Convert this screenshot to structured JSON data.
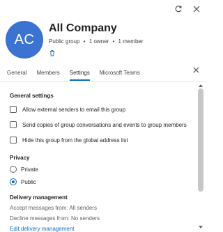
{
  "window": {
    "refresh_icon": "refresh-icon",
    "close_icon": "close-icon"
  },
  "group": {
    "initials": "AC",
    "name": "All Company",
    "type": "Public group",
    "owners": "1 owner",
    "members": "1 member",
    "avatar_color": "#3a73d1"
  },
  "tabs": [
    {
      "label": "General",
      "active": false
    },
    {
      "label": "Members",
      "active": false
    },
    {
      "label": "Settings",
      "active": true
    },
    {
      "label": "Microsoft Teams",
      "active": false
    }
  ],
  "settings": {
    "general_title": "General settings",
    "checkboxes": [
      "Allow external senders to email this group",
      "Send copies of group conversations and events to group members",
      "Hide this group from the global address list"
    ],
    "privacy_title": "Privacy",
    "privacy_options": [
      "Private",
      "Public"
    ],
    "privacy_selected": "Public",
    "delivery_title": "Delivery management",
    "accept_messages": "Accept messages from: All senders",
    "decline_messages": "Decline messages from: No senders",
    "edit_link": "Edit delivery management"
  },
  "colors": {
    "accent": "#0f6cbd"
  }
}
